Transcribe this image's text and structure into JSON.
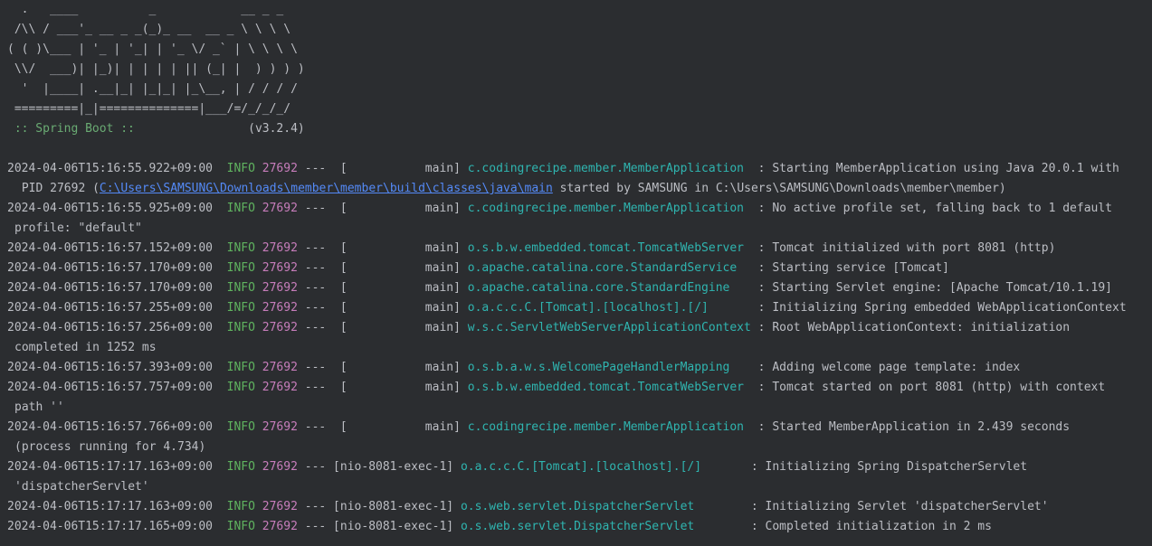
{
  "banner": {
    "lines": [
      "  .   ____          _            __ _ _",
      " /\\\\ / ___'_ __ _ _(_)_ __  __ _ \\ \\ \\ \\",
      "( ( )\\___ | '_ | '_| | '_ \\/ _` | \\ \\ \\ \\",
      " \\\\/  ___)| |_)| | | | | || (_| |  ) ) ) )",
      "  '  |____| .__|_| |_|_| |_\\__, | / / / /",
      " =========|_|==============|___/=/_/_/_/"
    ],
    "spring_label": " :: Spring Boot :: ",
    "version": "               (v3.2.4)"
  },
  "log": [
    {
      "ts": "2024-04-06T15:16:55.922+09:00",
      "level": "INFO",
      "pid": "27692",
      "thread": "---  [           main] ",
      "logger": "c.codingrecipe.member.MemberApplication ",
      "msg": " : Starting MemberApplication using Java 20.0.1 with",
      "cont_prefix": "PID 27692 (",
      "cont_link": "C:\\Users\\SAMSUNG\\Downloads\\member\\member\\build\\classes\\java\\main",
      "cont_suffix": " started by SAMSUNG in C:\\Users\\SAMSUNG\\Downloads\\member\\member)"
    },
    {
      "ts": "2024-04-06T15:16:55.925+09:00",
      "level": "INFO",
      "pid": "27692",
      "thread": "---  [           main] ",
      "logger": "c.codingrecipe.member.MemberApplication ",
      "msg": " : No active profile set, falling back to 1 default",
      "cont": "profile: \"default\""
    },
    {
      "ts": "2024-04-06T15:16:57.152+09:00",
      "level": "INFO",
      "pid": "27692",
      "thread": "---  [           main] ",
      "logger": "o.s.b.w.embedded.tomcat.TomcatWebServer ",
      "msg": " : Tomcat initialized with port 8081 (http)"
    },
    {
      "ts": "2024-04-06T15:16:57.170+09:00",
      "level": "INFO",
      "pid": "27692",
      "thread": "---  [           main] ",
      "logger": "o.apache.catalina.core.StandardService  ",
      "msg": " : Starting service [Tomcat]"
    },
    {
      "ts": "2024-04-06T15:16:57.170+09:00",
      "level": "INFO",
      "pid": "27692",
      "thread": "---  [           main] ",
      "logger": "o.apache.catalina.core.StandardEngine   ",
      "msg": " : Starting Servlet engine: [Apache Tomcat/10.1.19]"
    },
    {
      "ts": "2024-04-06T15:16:57.255+09:00",
      "level": "INFO",
      "pid": "27692",
      "thread": "---  [           main] ",
      "logger": "o.a.c.c.C.[Tomcat].[localhost].[/]      ",
      "msg": " : Initializing Spring embedded WebApplicationContext"
    },
    {
      "ts": "2024-04-06T15:16:57.256+09:00",
      "level": "INFO",
      "pid": "27692",
      "thread": "---  [           main] ",
      "logger": "w.s.c.ServletWebServerApplicationContext",
      "msg": " : Root WebApplicationContext: initialization",
      "cont": "completed in 1252 ms"
    },
    {
      "ts": "2024-04-06T15:16:57.393+09:00",
      "level": "INFO",
      "pid": "27692",
      "thread": "---  [           main] ",
      "logger": "o.s.b.a.w.s.WelcomePageHandlerMapping   ",
      "msg": " : Adding welcome page template: index"
    },
    {
      "ts": "2024-04-06T15:16:57.757+09:00",
      "level": "INFO",
      "pid": "27692",
      "thread": "---  [           main] ",
      "logger": "o.s.b.w.embedded.tomcat.TomcatWebServer ",
      "msg": " : Tomcat started on port 8081 (http) with context",
      "cont": "path ''"
    },
    {
      "ts": "2024-04-06T15:16:57.766+09:00",
      "level": "INFO",
      "pid": "27692",
      "thread": "---  [           main] ",
      "logger": "c.codingrecipe.member.MemberApplication ",
      "msg": " : Started MemberApplication in 2.439 seconds",
      "cont": "(process running for 4.734)"
    },
    {
      "ts": "2024-04-06T15:17:17.163+09:00",
      "level": "INFO",
      "pid": "27692",
      "thread": "--- [nio-8081-exec-1] ",
      "logger": "o.a.c.c.C.[Tomcat].[localhost].[/]      ",
      "msg": " : Initializing Spring DispatcherServlet",
      "cont": "'dispatcherServlet'"
    },
    {
      "ts": "2024-04-06T15:17:17.163+09:00",
      "level": "INFO",
      "pid": "27692",
      "thread": "--- [nio-8081-exec-1] ",
      "logger": "o.s.web.servlet.DispatcherServlet       ",
      "msg": " : Initializing Servlet 'dispatcherServlet'"
    },
    {
      "ts": "2024-04-06T15:17:17.165+09:00",
      "level": "INFO",
      "pid": "27692",
      "thread": "--- [nio-8081-exec-1] ",
      "logger": "o.s.web.servlet.DispatcherServlet       ",
      "msg": " : Completed initialization in 2 ms"
    }
  ],
  "colors": {
    "background": "#2b2d30",
    "text": "#bcbec4",
    "level_info": "#5fb35f",
    "pid": "#c77dbb",
    "logger": "#2fb5b0",
    "link": "#548af7",
    "spring_label": "#6aab73"
  }
}
